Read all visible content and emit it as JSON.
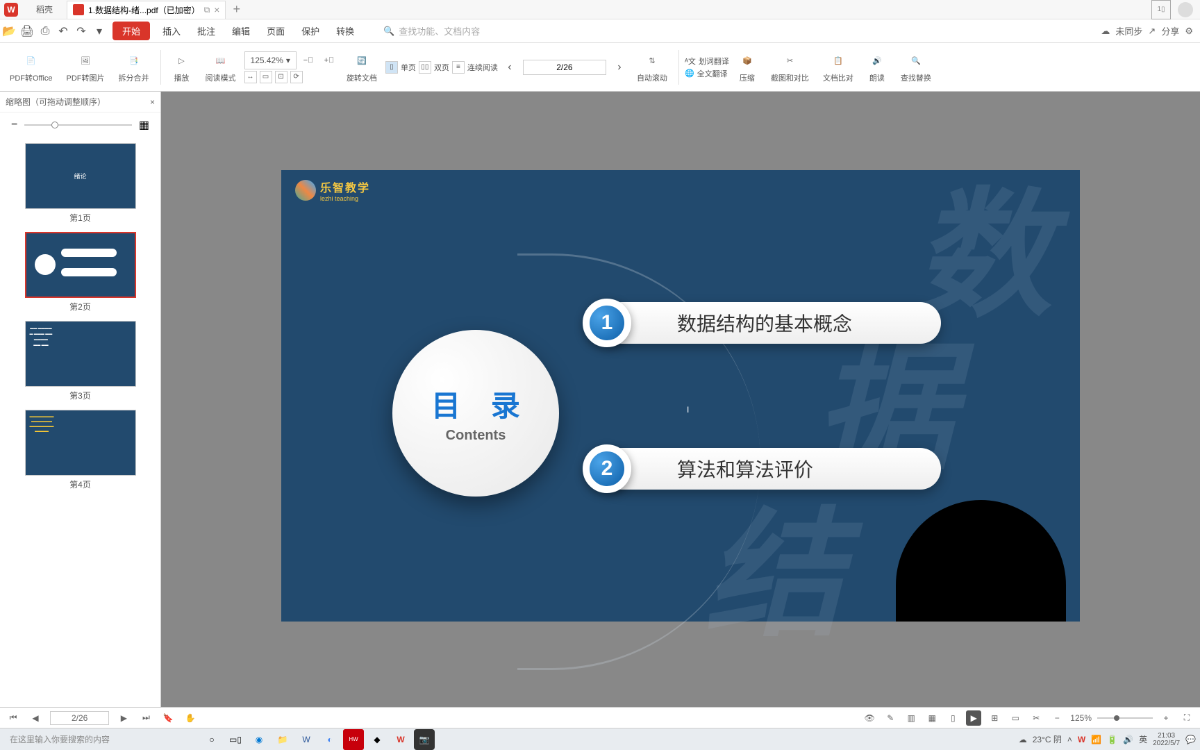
{
  "titlebar": {
    "home_tab": "稻壳",
    "file_tab": "1.数据结构-绪...pdf（已加密）",
    "window_number": "1"
  },
  "menubar": {
    "start": "开始",
    "items": [
      "插入",
      "批注",
      "编辑",
      "页面",
      "保护",
      "转换"
    ],
    "search_placeholder": "查找功能、文档内容",
    "sync": "未同步",
    "share": "分享"
  },
  "ribbon": {
    "pdf_to_office": "PDF转Office",
    "pdf_to_image": "PDF转图片",
    "split_merge": "拆分合并",
    "play": "播放",
    "read_mode": "阅读模式",
    "zoom_value": "125.42%",
    "rotate": "旋转文档",
    "single_page": "单页",
    "double_page": "双页",
    "continuous": "连续阅读",
    "page_indicator": "2/26",
    "auto_scroll": "自动滚动",
    "word_translate": "划词翻译",
    "full_translate": "全文翻译",
    "compress": "压缩",
    "screenshot_compare": "截图和对比",
    "doc_compare": "文档比对",
    "read_aloud": "朗读",
    "find_replace": "查找替换"
  },
  "thumbs": {
    "header": "缩略图（可拖动调整顺序）",
    "pages": [
      "第1页",
      "第2页",
      "第3页",
      "第4页"
    ],
    "p1_title": "绪论"
  },
  "slide": {
    "logo_cn": "乐智教学",
    "logo_en": "lezhi teaching",
    "mulu_cn": "目 录",
    "mulu_en": "Contents",
    "item1_num": "1",
    "item1_txt": "数据结构的基本概念",
    "item2_num": "2",
    "item2_txt": "算法和算法评价"
  },
  "status": {
    "page": "2/26",
    "zoom": "125%"
  },
  "taskbar": {
    "search": "在这里输入你要搜索的内容",
    "weather": "23°C 阴",
    "ime": "英",
    "time": "21:03",
    "date": "2022/5/7"
  }
}
